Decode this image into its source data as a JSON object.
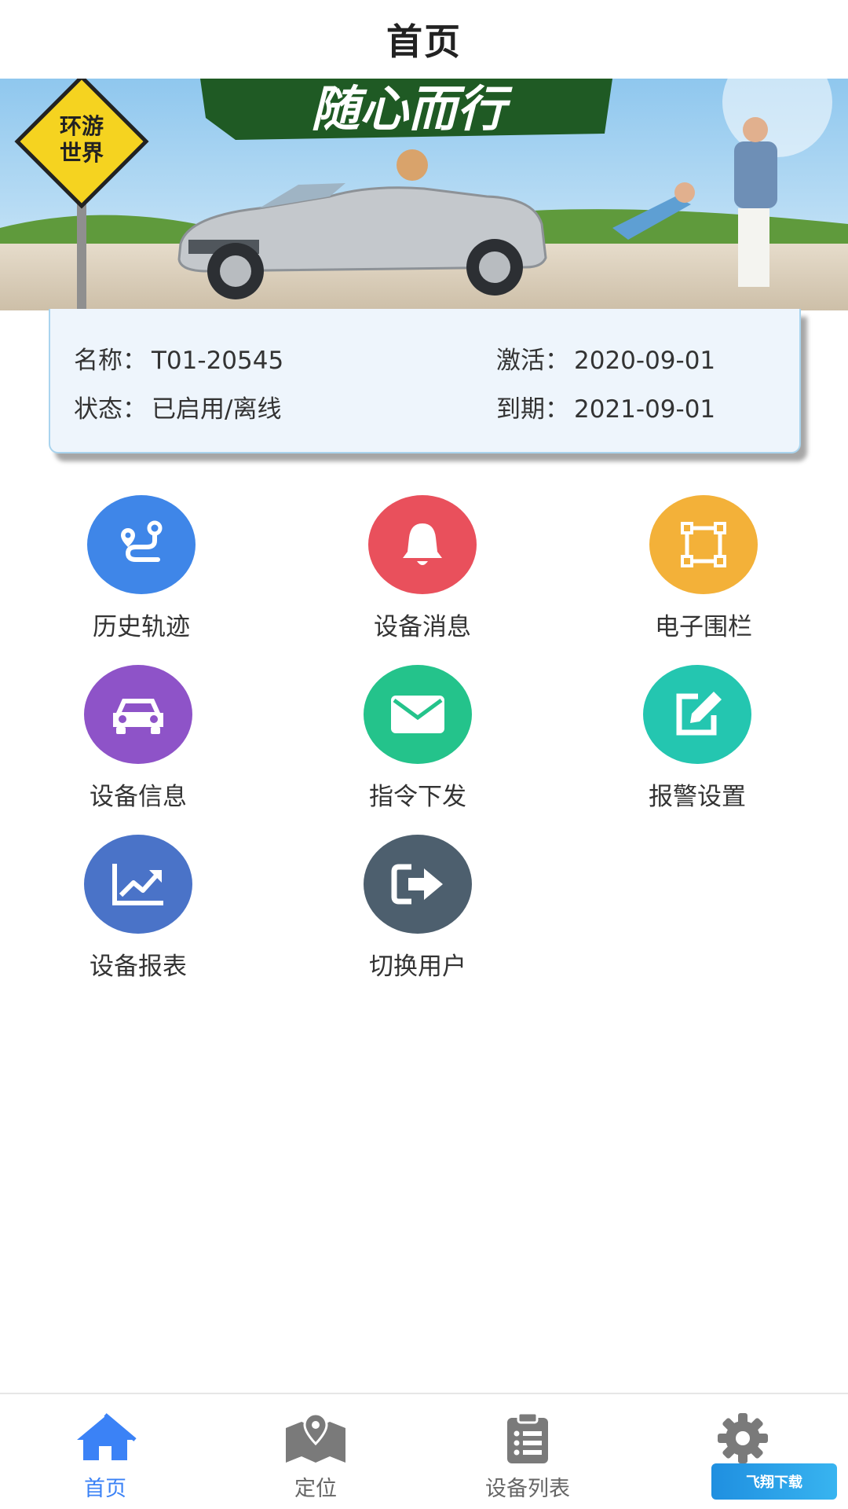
{
  "header": {
    "title": "首页"
  },
  "banner": {
    "slogan": "随心而行",
    "sign_line1": "环游",
    "sign_line2": "世界"
  },
  "device": {
    "name_label": "名称：",
    "name_value": "T01-20545",
    "status_label": "状态：",
    "status_value": "已启用/离线",
    "activate_label": "激活：",
    "activate_value": "2020-09-01",
    "expire_label": "到期：",
    "expire_value": "2021-09-01"
  },
  "functions": [
    {
      "label": "历史轨迹",
      "icon": "route-icon",
      "color": "#3f86e8"
    },
    {
      "label": "设备消息",
      "icon": "bell-icon",
      "color": "#e9505c"
    },
    {
      "label": "电子围栏",
      "icon": "fence-square-icon",
      "color": "#f3b139"
    },
    {
      "label": "设备信息",
      "icon": "car-icon",
      "color": "#8e53c8"
    },
    {
      "label": "指令下发",
      "icon": "envelope-icon",
      "color": "#24c38b"
    },
    {
      "label": "报警设置",
      "icon": "edit-icon",
      "color": "#24c6b0"
    },
    {
      "label": "设备报表",
      "icon": "chart-icon",
      "color": "#4a73c8"
    },
    {
      "label": "切换用户",
      "icon": "logout-icon",
      "color": "#4d5f6e"
    }
  ],
  "tabs": [
    {
      "label": "首页",
      "icon": "home-icon",
      "active": true
    },
    {
      "label": "定位",
      "icon": "map-pin-icon",
      "active": false
    },
    {
      "label": "设备列表",
      "icon": "clipboard-list-icon",
      "active": false
    },
    {
      "label": "设置",
      "icon": "gear-icon",
      "active": false
    }
  ],
  "colors": {
    "accent": "#3b82f6",
    "card_bg": "#eef5fc",
    "card_border": "#a9d4ee"
  },
  "watermark": {
    "text": "飞翔下载"
  }
}
